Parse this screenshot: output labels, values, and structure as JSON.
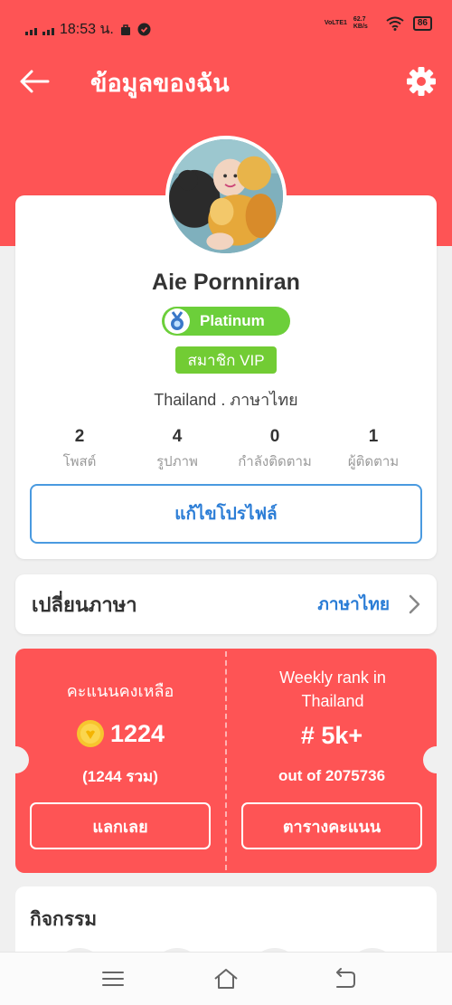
{
  "status_bar": {
    "time": "18:53 น.",
    "network_speed": "62.7 KB/s",
    "volte": "VoLTE1",
    "battery": "86"
  },
  "header": {
    "title": "ข้อมูลของฉัน"
  },
  "profile": {
    "name": "Aie Pornniran",
    "tier": "Platinum",
    "membership": "สมาชิก VIP",
    "location": "Thailand . ภาษาไทย",
    "stats": [
      {
        "value": "2",
        "label": "โพสต์"
      },
      {
        "value": "4",
        "label": "รูปภาพ"
      },
      {
        "value": "0",
        "label": "กำลังติดตาม"
      },
      {
        "value": "1",
        "label": "ผู้ติดตาม"
      }
    ],
    "edit_button": "แก้ไขโปรไฟล์"
  },
  "language": {
    "label": "เปลี่ยนภาษา",
    "value": "ภาษาไทย"
  },
  "points": {
    "left_title": "คะแนนคงเหลือ",
    "balance": "1224",
    "total": "(1244 รวม)",
    "redeem_button": "แลกเลย",
    "right_title_line1": "Weekly rank in",
    "right_title_line2": "Thailand",
    "rank": "# 5k+",
    "out_of": "out of 2075736",
    "leaderboard_button": "ตารางคะแนน"
  },
  "activity": {
    "title": "กิจกรรม"
  },
  "colors": {
    "primary_red": "#fe5455",
    "accent_blue": "#2b7dd6",
    "badge_green": "#6ccf3a"
  }
}
